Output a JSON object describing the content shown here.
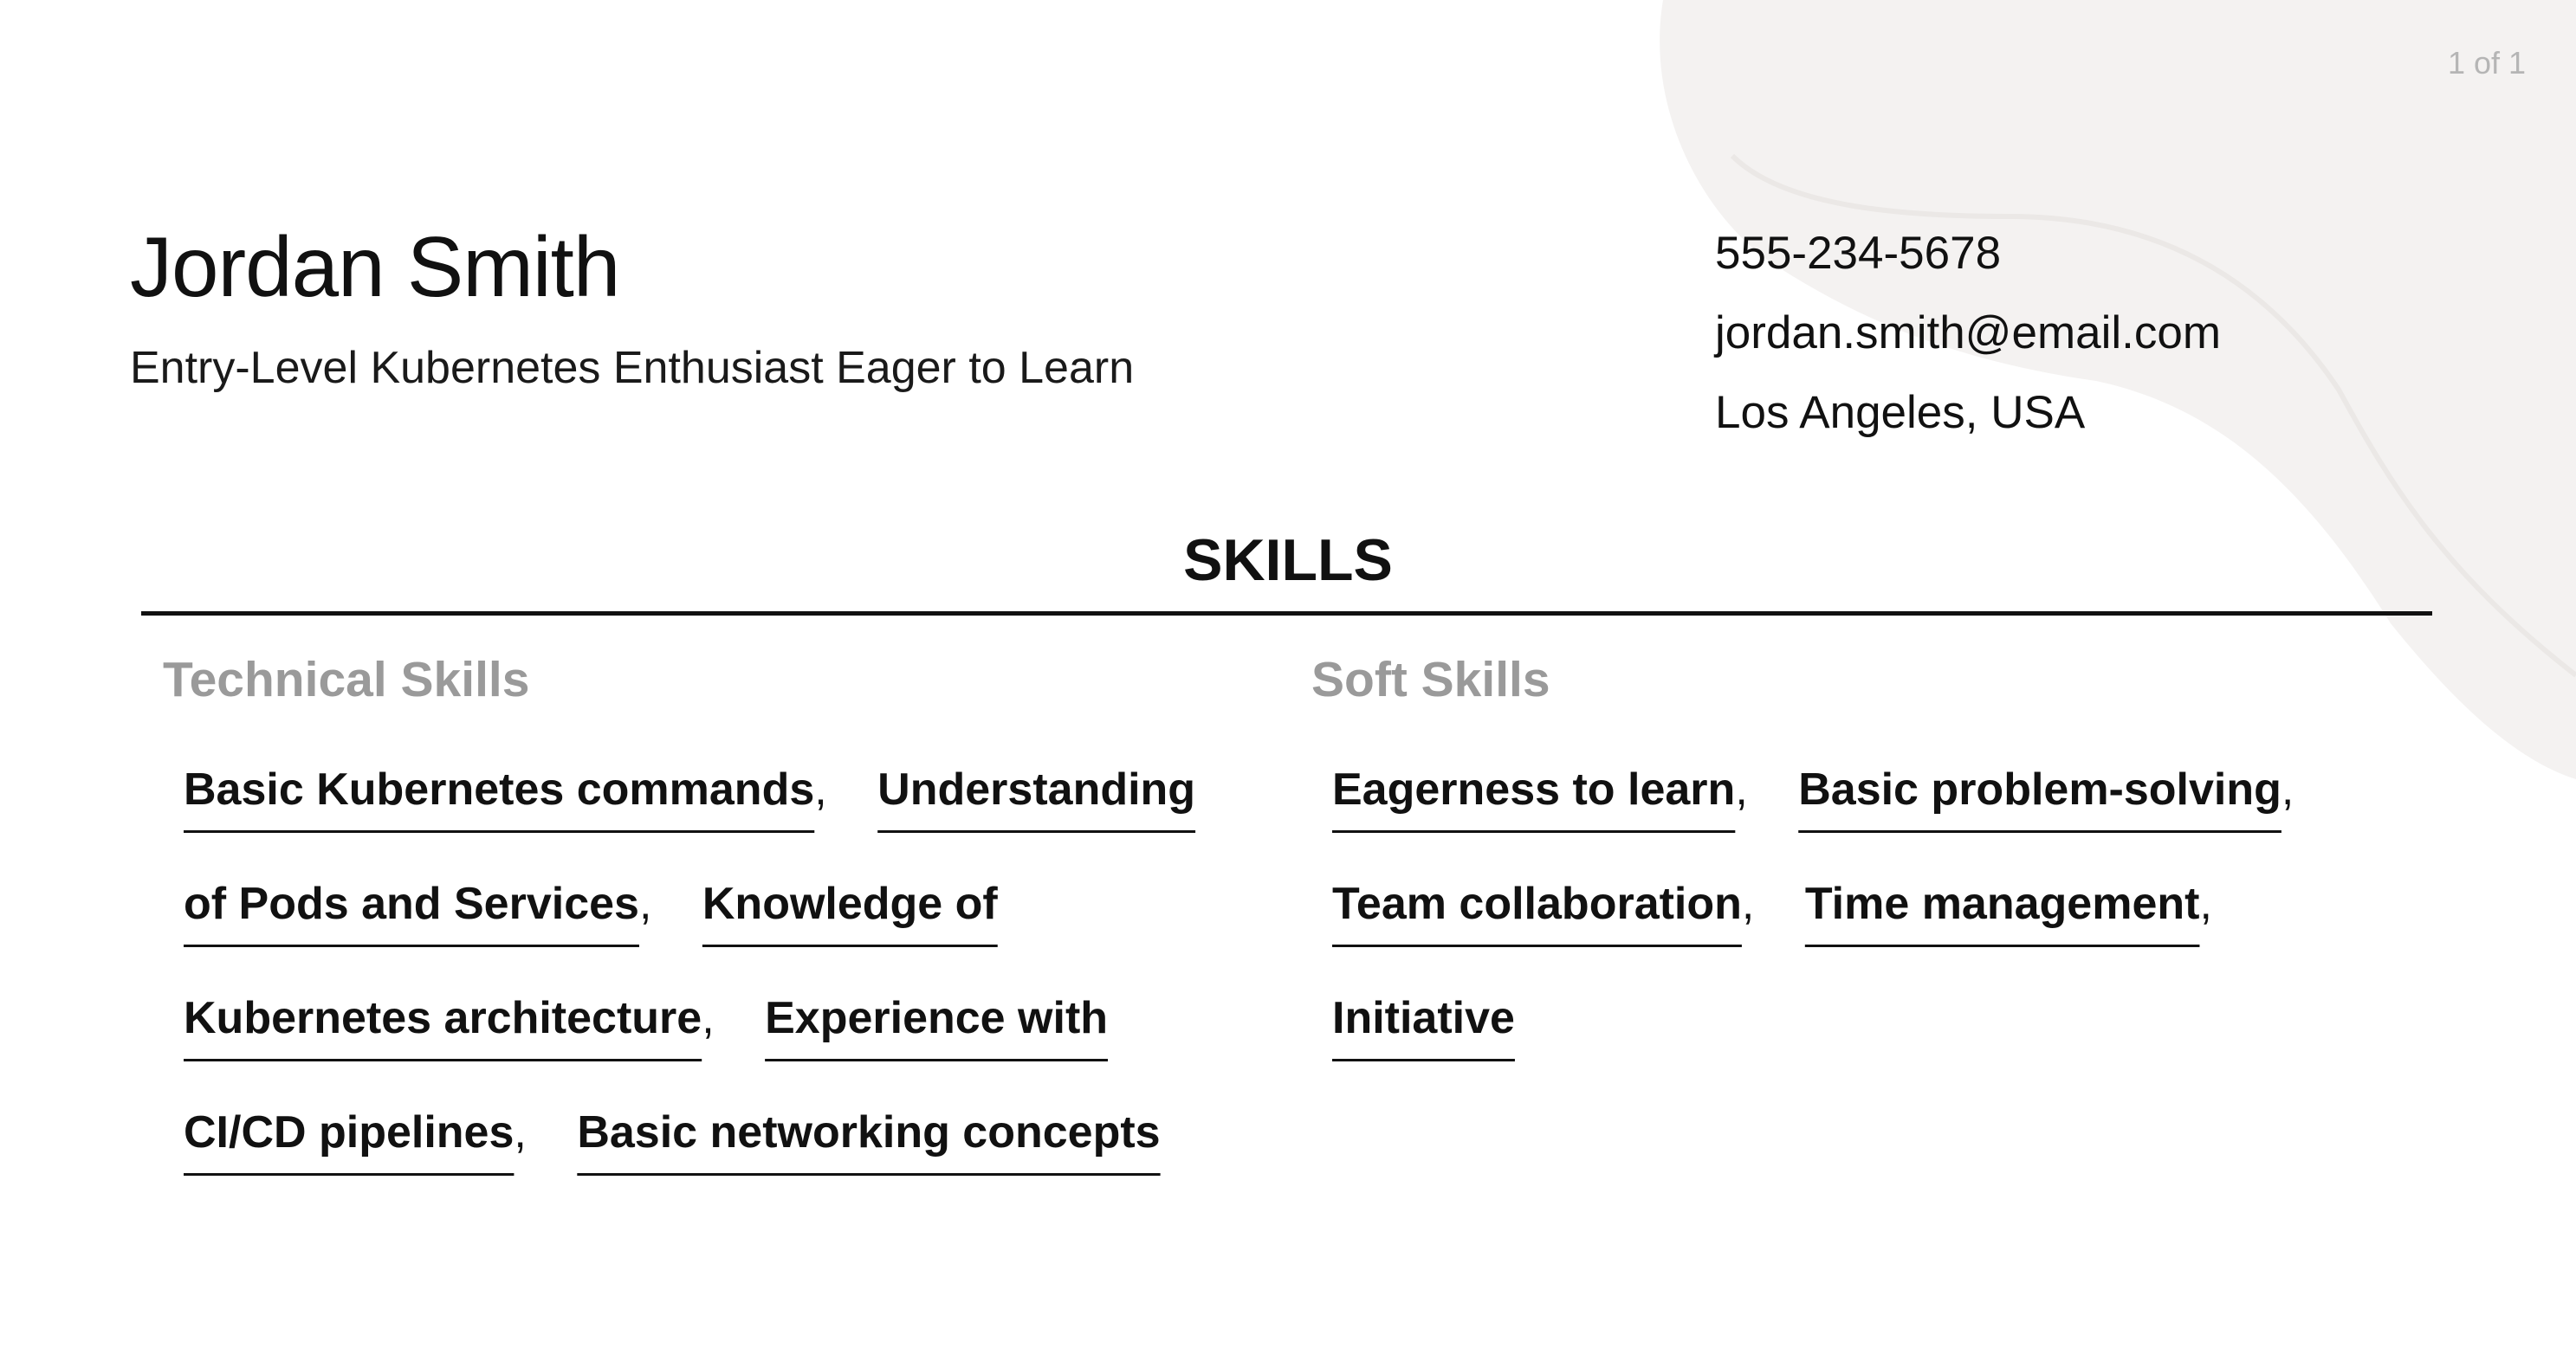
{
  "page_indicator": "1 of 1",
  "header": {
    "name": "Jordan Smith",
    "subtitle": "Entry-Level Kubernetes Enthusiast Eager to Learn",
    "phone": "555-234-5678",
    "email": "jordan.smith@email.com",
    "location": "Los Angeles, USA"
  },
  "skills": {
    "title": "SKILLS",
    "technical": {
      "title": "Technical Skills",
      "items": [
        "Basic Kubernetes commands",
        "Understanding of Pods and Services",
        "Knowledge of Kubernetes architecture",
        "Experience with CI/CD pipelines",
        "Basic networking concepts"
      ]
    },
    "soft": {
      "title": "Soft Skills",
      "items": [
        "Eagerness to learn",
        "Basic problem-solving",
        "Team collaboration",
        "Time management",
        "Initiative"
      ]
    },
    "separator": ","
  },
  "colors": {
    "background_shape": "#f4f2f1",
    "subheading": "#9a9a9a",
    "text": "#111111"
  }
}
